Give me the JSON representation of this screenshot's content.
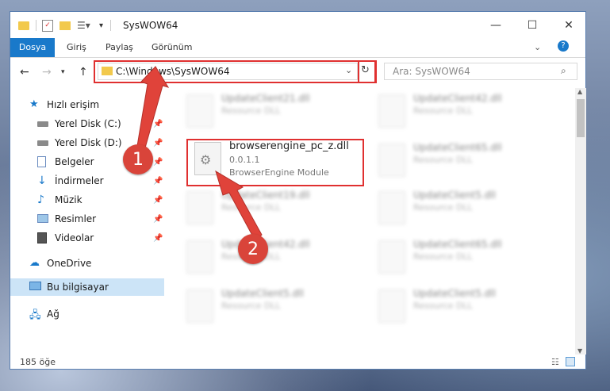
{
  "window": {
    "title": "SysWOW64"
  },
  "ribbon": {
    "tabs": [
      "Dosya",
      "Giriş",
      "Paylaş",
      "Görünüm"
    ]
  },
  "address": {
    "path": "C:\\Windows\\SysWOW64"
  },
  "search": {
    "placeholder": "Ara: SysWOW64"
  },
  "sidebar": {
    "items": [
      {
        "label": "Hızlı erişim",
        "icon": "star-icon"
      },
      {
        "label": "Yerel Disk (C:)",
        "icon": "drive-icon",
        "pinned": true
      },
      {
        "label": "Yerel Disk (D:)",
        "icon": "drive-icon",
        "pinned": true
      },
      {
        "label": "Belgeler",
        "icon": "documents-icon",
        "pinned": true
      },
      {
        "label": "İndirmeler",
        "icon": "download-icon",
        "pinned": true
      },
      {
        "label": "Müzik",
        "icon": "music-icon",
        "pinned": true
      },
      {
        "label": "Resimler",
        "icon": "pictures-icon",
        "pinned": true
      },
      {
        "label": "Videolar",
        "icon": "videos-icon",
        "pinned": true
      },
      {
        "label": "OneDrive",
        "icon": "cloud-icon"
      },
      {
        "label": "Bu bilgisayar",
        "icon": "computer-icon",
        "selected": true
      },
      {
        "label": "Ağ",
        "icon": "network-icon"
      }
    ]
  },
  "files": {
    "focused": {
      "name": "browserengine_pc_z.dll",
      "version": "0.0.1.1",
      "description": "BrowserEngine Module"
    },
    "left_column": [
      {
        "name": "UpdateClient21.dll",
        "sub": "Resource DLL"
      },
      {
        "name": "UpdateClient19.dll",
        "sub": "Resource DLL"
      },
      {
        "name": "UpdateClient42.dll",
        "sub": "Resource DLL"
      },
      {
        "name": "UpdateClient5.dll",
        "sub": "Resource DLL"
      }
    ],
    "right_column": [
      {
        "name": "UpdateClient42.dll",
        "sub": "Resource DLL"
      },
      {
        "name": "UpdateClient65.dll",
        "sub": "Resource DLL"
      },
      {
        "name": "UpdateClient5.dll",
        "sub": "Resource DLL"
      },
      {
        "name": "UpdateClient65.dll",
        "sub": "Resource DLL"
      },
      {
        "name": "UpdateClient5.dll",
        "sub": "Resource DLL"
      }
    ]
  },
  "status": {
    "count": "185 öğe"
  },
  "annotations": {
    "step1": "1",
    "step2": "2"
  },
  "colors": {
    "accent": "#1979ca",
    "highlight": "#e03030",
    "selected": "#cce4f7"
  }
}
